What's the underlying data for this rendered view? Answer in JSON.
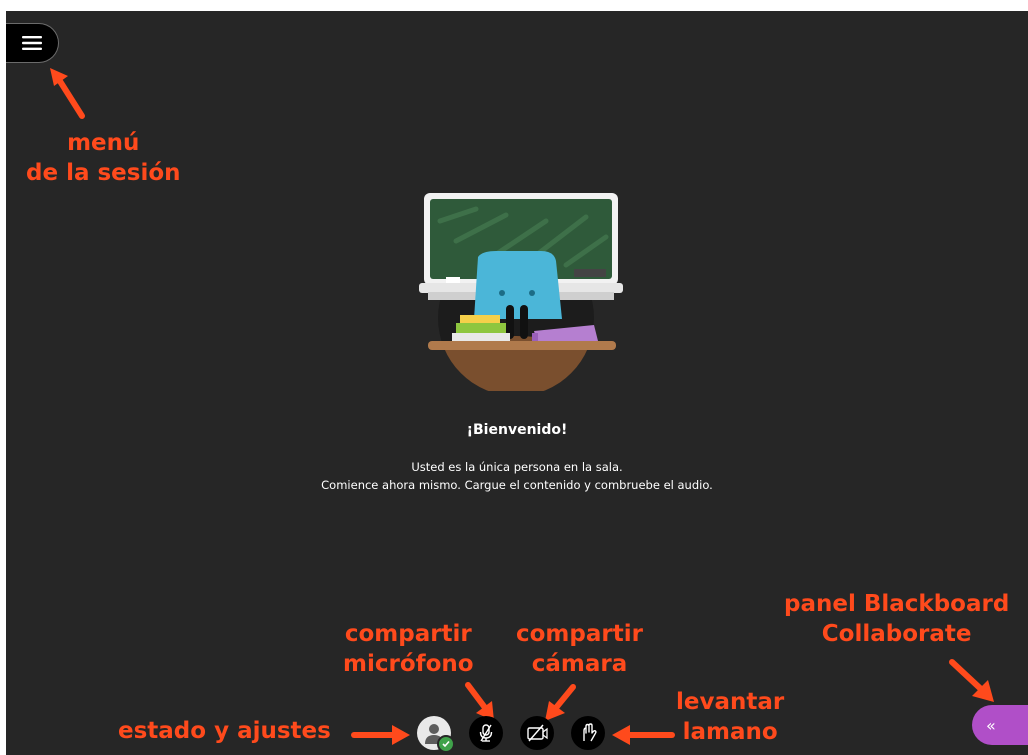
{
  "welcome": {
    "title": "¡Bienvenido!",
    "line1": "Usted es la única persona en la sala.",
    "line2": "Comience ahora mismo. Cargue el contenido y combruebe el audio."
  },
  "annotations": {
    "menu_line1": "menú",
    "menu_line2": "de la sesión",
    "panel_line1": "panel Blackboard",
    "panel_line2": "Collaborate",
    "mic_line1": "compartir",
    "mic_line2": "micrófono",
    "cam_line1": "compartir",
    "cam_line2": "cámara",
    "hand_line1": "levantar",
    "hand_line2": "lamano",
    "status": "estado y ajustes"
  },
  "controls": {
    "menu_icon": "hamburger-icon",
    "avatar_icon": "user-avatar-icon",
    "status_icon": "check-icon",
    "mic_icon": "microphone-off-icon",
    "camera_icon": "camera-off-icon",
    "hand_icon": "raise-hand-icon",
    "panel_icon": "double-chevron-left-icon",
    "panel_glyph": "«"
  },
  "colors": {
    "background": "#262626",
    "annotation": "#ff4a1c",
    "panel_accent": "#b04fc8",
    "status_ok": "#3fa24a"
  }
}
